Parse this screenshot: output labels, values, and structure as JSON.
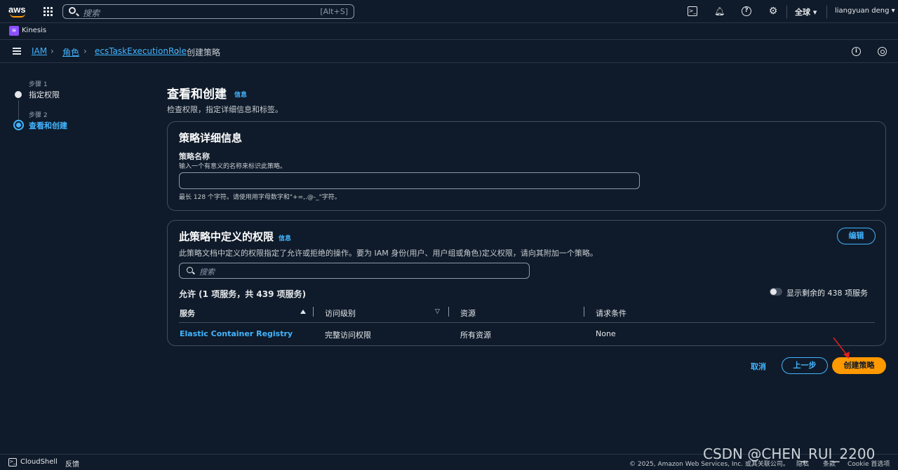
{
  "topnav": {
    "logo_text": "aws",
    "search_placeholder": "搜索",
    "search_shortcut": "[Alt+S]",
    "region": "全球 ▾",
    "user": "liangyuan deng ▾"
  },
  "service_bar": {
    "service_name": "Kinesis"
  },
  "breadcrumb": {
    "items": [
      "IAM",
      "角色",
      "ecsTaskExecutionRole",
      "创建策略"
    ]
  },
  "steps": [
    {
      "label": "步骤 1",
      "name": "指定权限"
    },
    {
      "label": "步骤 2",
      "name": "查看和创建"
    }
  ],
  "page": {
    "title": "查看和创建",
    "info": "信息",
    "description": "检查权限，指定详细信息和标签。"
  },
  "policy_details": {
    "title": "策略详细信息",
    "name_label": "策略名称",
    "name_desc": "输入一个有意义的名称来标识此策略。",
    "name_value": "",
    "name_hint": "最长 128 个字符。请使用用字母数字和\"+=,.@-_\"字符。"
  },
  "permissions": {
    "title": "此策略中定义的权限",
    "info": "信息",
    "description": "此策略文档中定义的权限指定了允许或拒绝的操作。要为 IAM 身份(用户、用户组或角色)定义权限，请向其附加一个策略。",
    "edit_label": "编辑",
    "search_placeholder": "搜索",
    "allow_title": "允许 (1 项服务，共 439 项服务)",
    "toggle_label": "显示剩余的 438 项服务",
    "columns": [
      "服务",
      "访问级别",
      "资源",
      "请求条件"
    ],
    "rows": [
      {
        "service": "Elastic Container Registry",
        "access": "完整访问权限",
        "resource": "所有资源",
        "condition": "None"
      }
    ]
  },
  "actions": {
    "cancel": "取消",
    "previous": "上一步",
    "create": "创建策略"
  },
  "footer": {
    "cloudshell": "CloudShell",
    "feedback": "反馈",
    "copyright": "© 2025, Amazon Web Services, Inc. 或其关联公司。",
    "privacy": "隐私",
    "terms": "条款",
    "cookie": "Cookie 首选项"
  },
  "watermark": "CSDN @CHEN_RUI_2200",
  "colors": {
    "background": "#0f1b2a",
    "link": "#42b4ff",
    "primary_button": "#ff9900",
    "annotation_arrow": "#e02020"
  }
}
